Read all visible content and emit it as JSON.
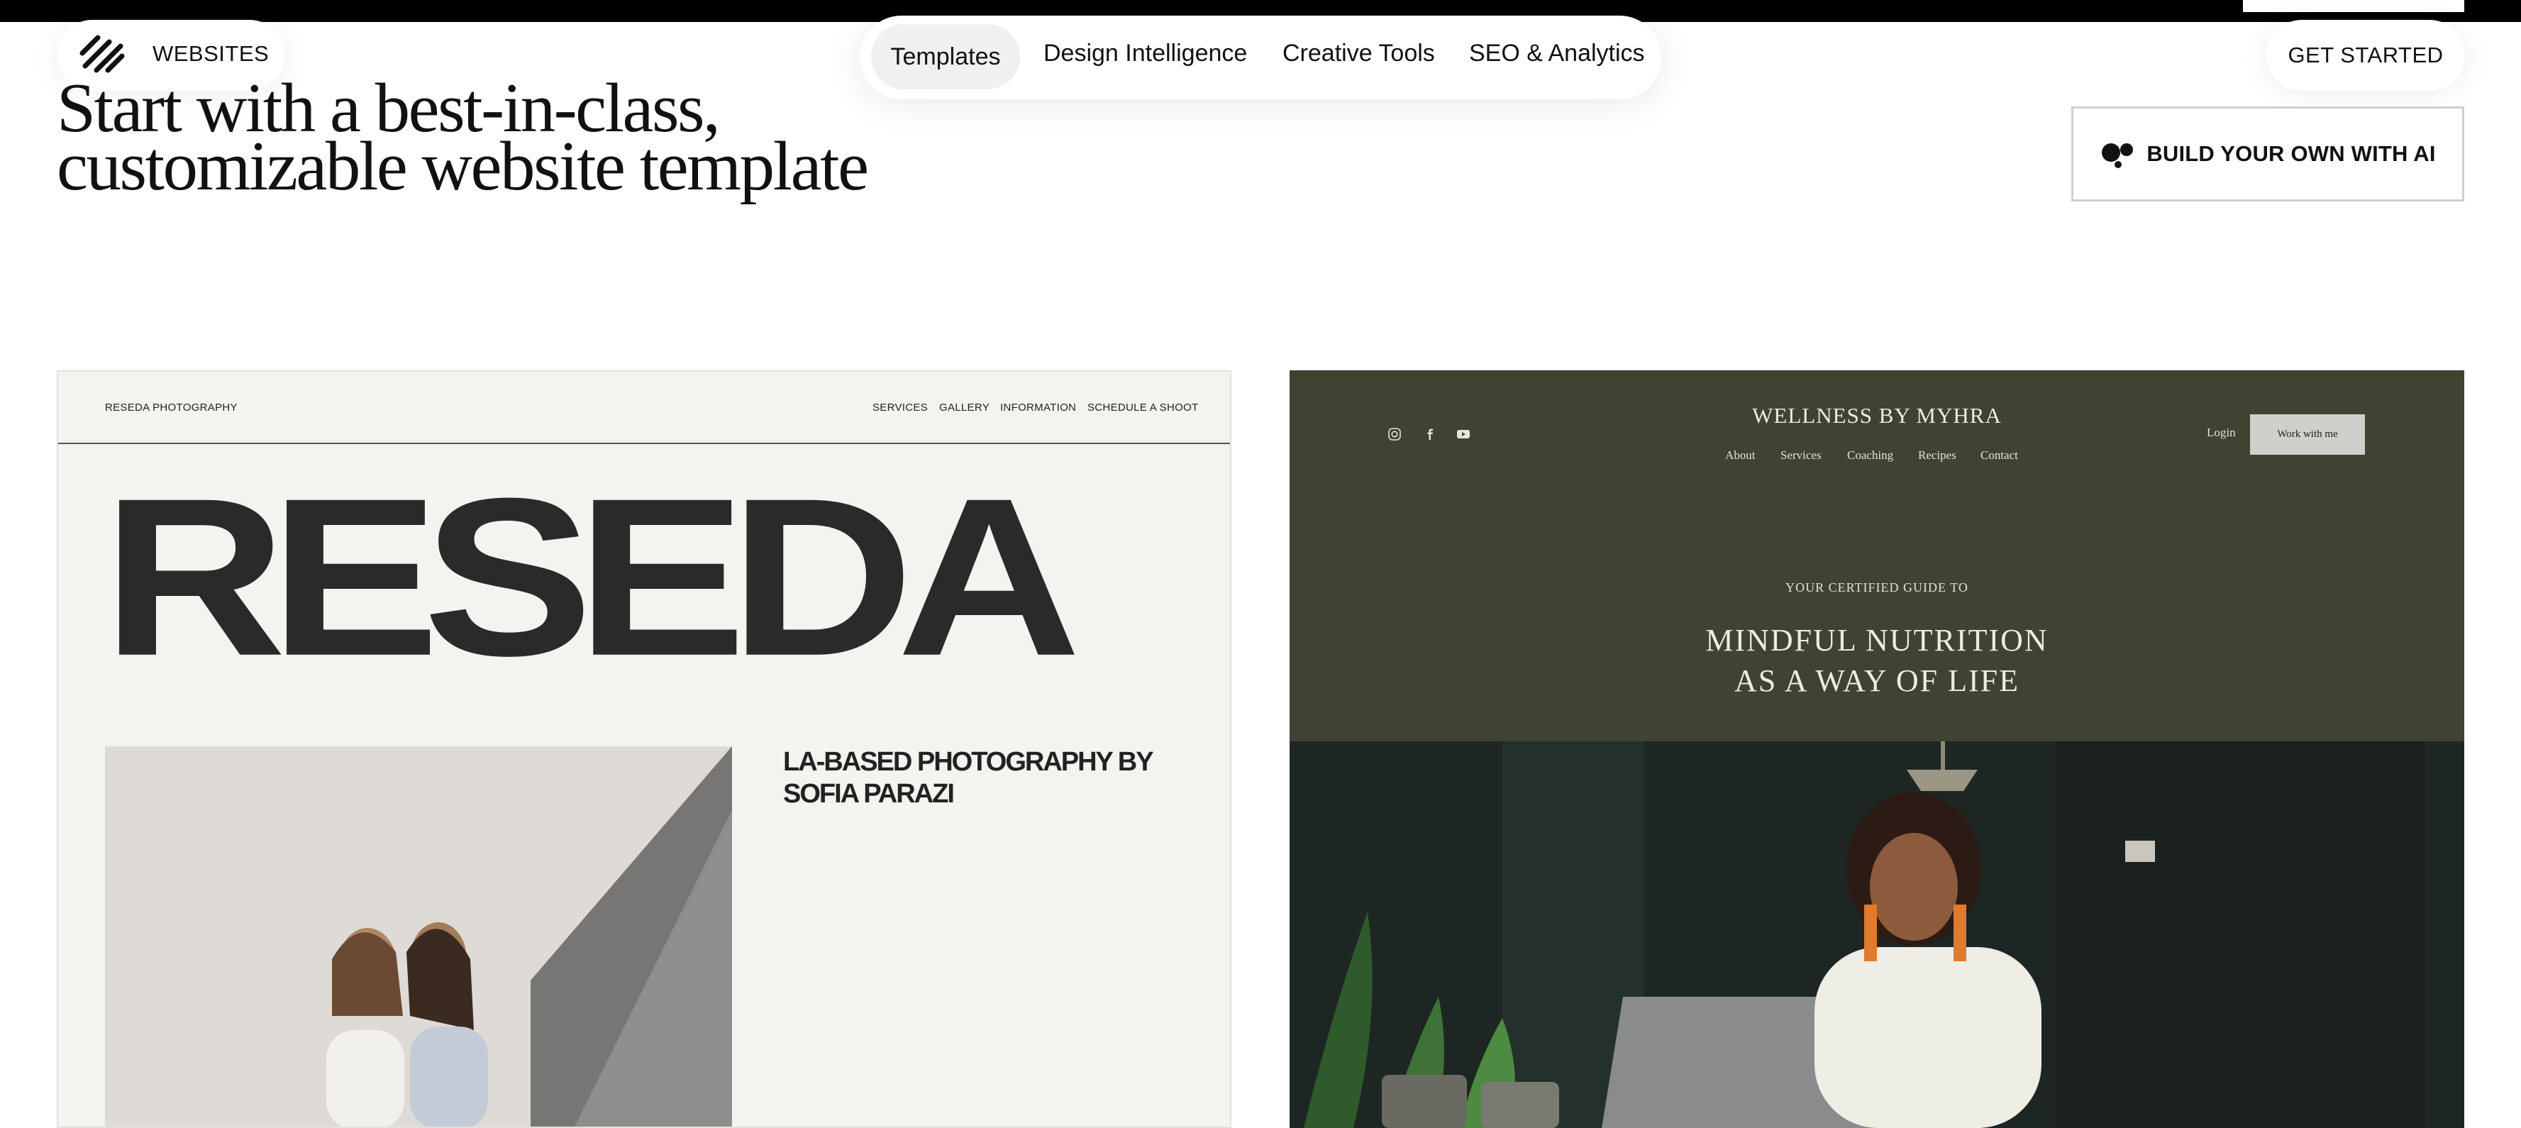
{
  "header": {
    "brand": "WEBSITES",
    "logo_icon": "squarespace-logo-icon",
    "nav": [
      "Templates",
      "Design Intelligence",
      "Creative Tools",
      "SEO & Analytics"
    ],
    "active_nav": "Templates",
    "cta": "GET STARTED"
  },
  "hero": {
    "headline_line1": "Start with a best-in-class,",
    "headline_line2": "customizable website template",
    "ai_button": "BUILD YOUR OWN WITH AI",
    "ai_icon": "ai-dots-icon"
  },
  "templates": [
    {
      "brand": "RESEDA PHOTOGRAPHY",
      "nav": [
        "SERVICES",
        "GALLERY",
        "INFORMATION",
        "SCHEDULE A SHOOT"
      ],
      "hero": "RESEDA",
      "tagline_line1": "LA-BASED PHOTOGRAPHY BY",
      "tagline_line2": "SOFIA PARAZI"
    },
    {
      "title": "WELLNESS BY MYHRA",
      "social_icons": [
        "instagram-icon",
        "facebook-icon",
        "youtube-icon"
      ],
      "nav": [
        "About",
        "Services",
        "Coaching",
        "Recipes",
        "Contact"
      ],
      "login": "Login",
      "cta": "Work with me",
      "eyebrow": "YOUR CERTIFIED GUIDE TO",
      "headline_line1": "MINDFUL NUTRITION",
      "headline_line2": "AS A WAY OF LIFE"
    }
  ],
  "colors": {
    "wellness_green": "#3e4332",
    "reseda_bg": "#f3f3ef"
  }
}
